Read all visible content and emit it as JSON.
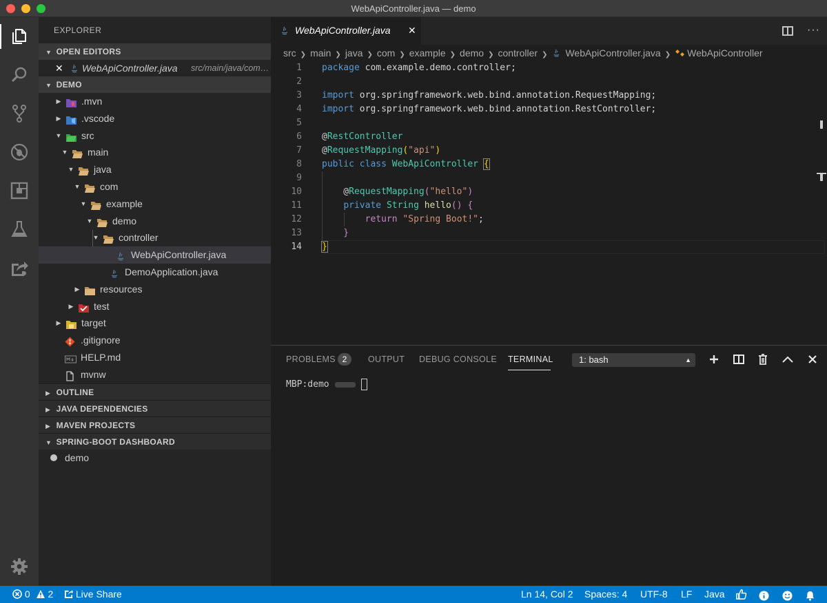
{
  "window": {
    "title": "WebApiController.java — demo"
  },
  "colors": {
    "accent": "#007acc",
    "selection": "#37373d",
    "folder": "#dcb67a"
  },
  "activity_bar": {
    "items": [
      "files-icon",
      "search-icon",
      "source-control-icon",
      "debug-icon",
      "extensions-icon",
      "test-icon",
      "live-share-icon"
    ],
    "bottom": "gear-icon"
  },
  "explorer": {
    "title": "EXPLORER",
    "open_editors": {
      "header": "OPEN EDITORS",
      "close_glyph": "✕",
      "file": "WebApiController.java",
      "path": "src/main/java/com/example/demo/controller"
    },
    "project": {
      "header": "DEMO"
    },
    "tree": [
      {
        "label": ".mvn",
        "twisty": "▶",
        "icon": "mvn-folder-icon"
      },
      {
        "label": ".vscode",
        "twisty": "▶",
        "icon": "vscode-folder-icon"
      },
      {
        "label": "src",
        "twisty": "▼",
        "icon": "src-folder-icon"
      },
      {
        "label": "main",
        "twisty": "▼",
        "icon": "folder-open-icon"
      },
      {
        "label": "java",
        "twisty": "▼",
        "icon": "folder-open-icon"
      },
      {
        "label": "com",
        "twisty": "▼",
        "icon": "folder-open-icon"
      },
      {
        "label": "example",
        "twisty": "▼",
        "icon": "folder-open-icon"
      },
      {
        "label": "demo",
        "twisty": "▼",
        "icon": "folder-open-icon"
      },
      {
        "label": "controller",
        "twisty": "▼",
        "icon": "folder-open-icon"
      },
      {
        "label": "WebApiController.java",
        "twisty": "",
        "icon": "java-file-icon"
      },
      {
        "label": "DemoApplication.java",
        "twisty": "",
        "icon": "java-file-icon"
      },
      {
        "label": "resources",
        "twisty": "▶",
        "icon": "folder-icon"
      },
      {
        "label": "test",
        "twisty": "▶",
        "icon": "test-folder-icon"
      },
      {
        "label": "target",
        "twisty": "▶",
        "icon": "target-folder-icon"
      },
      {
        "label": ".gitignore",
        "twisty": "",
        "icon": "git-file-icon"
      },
      {
        "label": "HELP.md",
        "twisty": "",
        "icon": "markdown-file-icon"
      },
      {
        "label": "mvnw",
        "twisty": "",
        "icon": "file-icon"
      }
    ],
    "sections": [
      "OUTLINE",
      "JAVA DEPENDENCIES",
      "MAVEN PROJECTS"
    ],
    "dashboard": {
      "header": "SPRING-BOOT DASHBOARD",
      "items": [
        "demo"
      ]
    }
  },
  "editor": {
    "tab": {
      "label": "WebApiController.java",
      "close_glyph": "✕"
    },
    "breadcrumb": [
      "src",
      "main",
      "java",
      "com",
      "example",
      "demo",
      "controller",
      "WebApiController.java",
      "WebApiController"
    ],
    "current_line": 14,
    "lines": [
      [
        {
          "t": "package",
          "c": "kw"
        },
        {
          "t": " com.example.demo.controller;",
          "c": "pl"
        }
      ],
      [],
      [
        {
          "t": "import",
          "c": "kw"
        },
        {
          "t": " org.springframework.web.bind.annotation.RequestMapping;",
          "c": "pl"
        }
      ],
      [
        {
          "t": "import",
          "c": "kw"
        },
        {
          "t": " org.springframework.web.bind.annotation.RestController;",
          "c": "pl"
        }
      ],
      [],
      [
        {
          "t": "@",
          "c": "pl"
        },
        {
          "t": "RestController",
          "c": "ann"
        }
      ],
      [
        {
          "t": "@",
          "c": "pl"
        },
        {
          "t": "RequestMapping",
          "c": "ann"
        },
        {
          "t": "(",
          "c": "br-y"
        },
        {
          "t": "\"api\"",
          "c": "str"
        },
        {
          "t": ")",
          "c": "br-y"
        }
      ],
      [
        {
          "t": "public",
          "c": "kw"
        },
        {
          "t": " ",
          "c": "pl"
        },
        {
          "t": "class",
          "c": "kw"
        },
        {
          "t": " ",
          "c": "pl"
        },
        {
          "t": "WebApiController",
          "c": "ann"
        },
        {
          "t": " ",
          "c": "pl"
        },
        {
          "t": "{",
          "c": "br-y br-box"
        }
      ],
      [],
      [
        {
          "t": "    @",
          "c": "pl"
        },
        {
          "t": "RequestMapping",
          "c": "ann"
        },
        {
          "t": "(",
          "c": "pk"
        },
        {
          "t": "\"hello\"",
          "c": "str"
        },
        {
          "t": ")",
          "c": "pk"
        }
      ],
      [
        {
          "t": "    ",
          "c": "pl"
        },
        {
          "t": "private",
          "c": "kw"
        },
        {
          "t": " ",
          "c": "pl"
        },
        {
          "t": "String",
          "c": "ann"
        },
        {
          "t": " ",
          "c": "pl"
        },
        {
          "t": "hello",
          "c": "fn"
        },
        {
          "t": "() {",
          "c": "pk"
        }
      ],
      [
        {
          "t": "        ",
          "c": "pl"
        },
        {
          "t": "return",
          "c": "pk"
        },
        {
          "t": " ",
          "c": "pl"
        },
        {
          "t": "\"Spring Boot!\"",
          "c": "str"
        },
        {
          "t": ";",
          "c": "pl"
        }
      ],
      [
        {
          "t": "    }",
          "c": "pk"
        }
      ],
      [
        {
          "t": "}",
          "c": "br-y br-box"
        }
      ]
    ]
  },
  "panel": {
    "tabs": [
      "PROBLEMS",
      "OUTPUT",
      "DEBUG CONSOLE",
      "TERMINAL"
    ],
    "active_tab": "TERMINAL",
    "problems_count": "2",
    "terminal_select": "1: bash",
    "prompt": "MBP:demo"
  },
  "status_bar": {
    "errors": "0",
    "warnings": "2",
    "live_share": "Live Share",
    "position": "Ln 14, Col 2",
    "spaces": "Spaces: 4",
    "encoding": "UTF-8",
    "eol": "LF",
    "language": "Java"
  }
}
